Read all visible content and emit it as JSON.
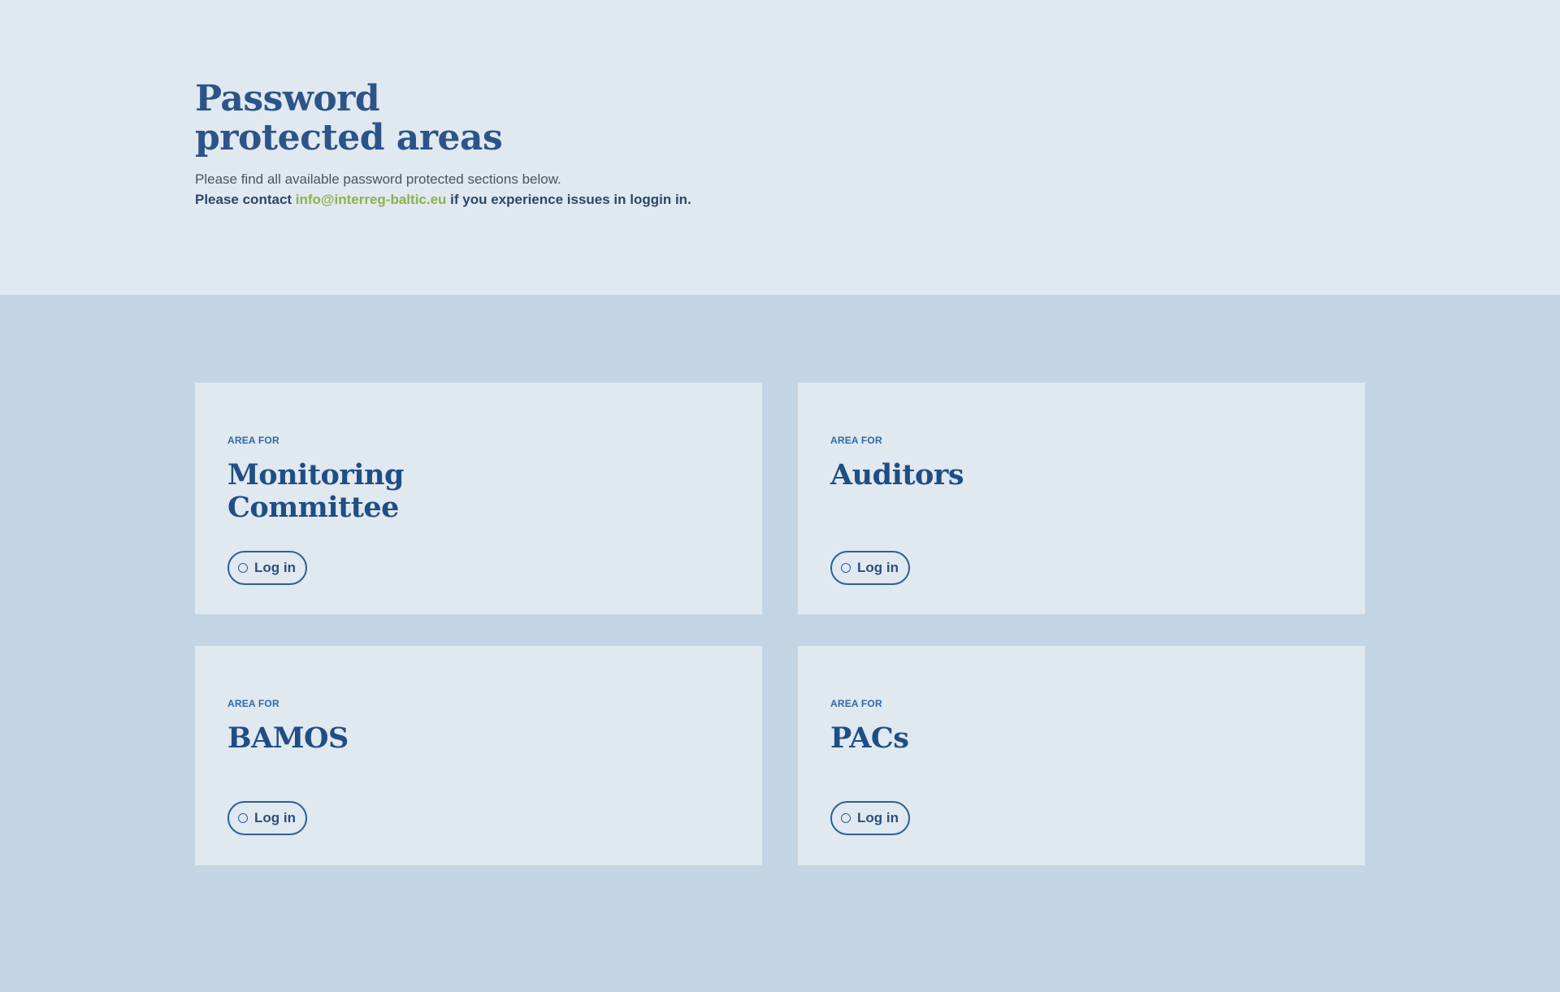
{
  "hero": {
    "title_line1": "Password",
    "title_line2": "protected areas",
    "intro": "Please find all available password protected sections below.",
    "contact_prefix": "Please contact ",
    "contact_email": "info@interreg-baltic.eu",
    "contact_suffix": " if you experience issues in loggin in."
  },
  "cards": [
    {
      "label": "AREA FOR",
      "title_line1": "Monitoring",
      "title_line2": "Committee",
      "button": "Log in"
    },
    {
      "label": "AREA FOR",
      "title_line1": "Auditors",
      "title_line2": "",
      "button": "Log in"
    },
    {
      "label": "AREA FOR",
      "title_line1": "BAMOS",
      "title_line2": "",
      "button": "Log in"
    },
    {
      "label": "AREA FOR",
      "title_line1": "PACs",
      "title_line2": "",
      "button": "Log in"
    }
  ],
  "colors": {
    "hero_background": "#e0e8f0",
    "page_background": "#c3d5e4",
    "heading_blue": "#2c5489",
    "link_green": "#8ab34a",
    "button_border": "#2e5f96"
  }
}
